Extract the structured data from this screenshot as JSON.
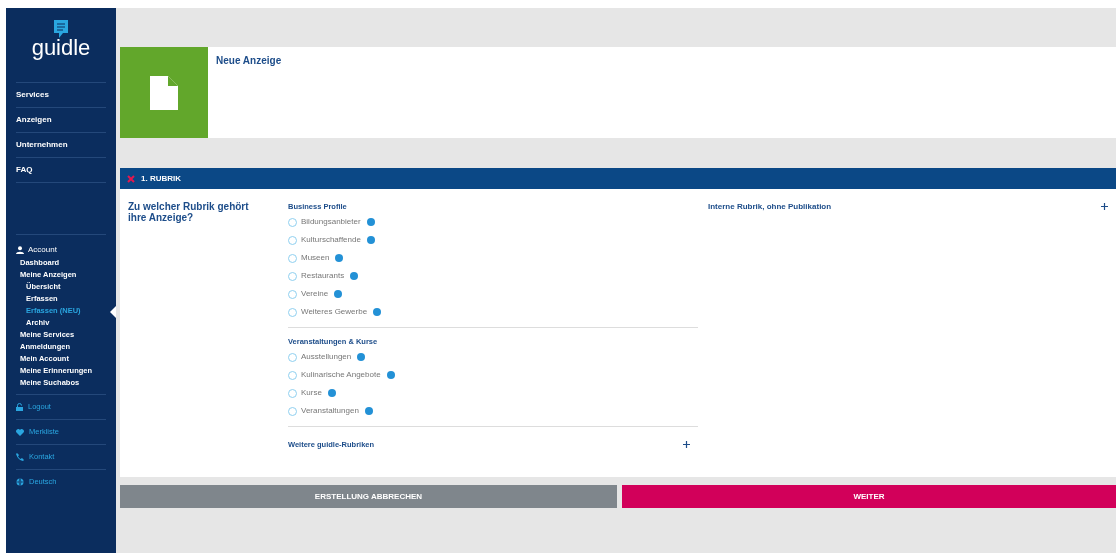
{
  "sidebar": {
    "logo": "guidle",
    "main_nav": [
      {
        "label": "Services"
      },
      {
        "label": "Anzeigen"
      },
      {
        "label": "Unternehmen"
      },
      {
        "label": "FAQ"
      }
    ],
    "account": {
      "label": "Account",
      "items": [
        {
          "label": "Dashboard",
          "selected": false
        },
        {
          "label": "Meine Anzeigen",
          "selected": false,
          "children": [
            {
              "label": "Übersicht",
              "selected": false
            },
            {
              "label": "Erfassen",
              "selected": false
            },
            {
              "label": "Erfassen (NEU)",
              "selected": true
            },
            {
              "label": "Archiv",
              "selected": false
            }
          ]
        },
        {
          "label": "Meine Services",
          "selected": false
        },
        {
          "label": "Anmeldungen",
          "selected": false
        },
        {
          "label": "Mein Account",
          "selected": false
        },
        {
          "label": "Meine Erinnerungen",
          "selected": false
        },
        {
          "label": "Meine Suchabos",
          "selected": false
        }
      ]
    },
    "footer_links": [
      {
        "kind": "lock",
        "label": "Logout"
      },
      {
        "kind": "heart",
        "label": "Merkliste"
      },
      {
        "kind": "phone",
        "label": "Kontakt"
      },
      {
        "kind": "globe",
        "label": "Deutsch"
      }
    ]
  },
  "header": {
    "title": "Neue Anzeige"
  },
  "section": {
    "title": "1. RUBRIK",
    "question": "Zu welcher Rubrik gehört ihre Anzeige?",
    "groups": [
      {
        "title": "Business Profile",
        "options": [
          {
            "label": "Bildungsanbieter",
            "selected": false
          },
          {
            "label": "Kulturschaffende",
            "selected": false
          },
          {
            "label": "Museen",
            "selected": false
          },
          {
            "label": "Restaurants",
            "selected": false
          },
          {
            "label": "Vereine",
            "selected": false
          },
          {
            "label": "Weiteres Gewerbe",
            "selected": false
          }
        ]
      },
      {
        "title": "Veranstaltungen & Kurse",
        "options": [
          {
            "label": "Ausstellungen",
            "selected": false
          },
          {
            "label": "Kulinarische Angebote",
            "selected": false
          },
          {
            "label": "Kurse",
            "selected": false
          },
          {
            "label": "Veranstaltungen",
            "selected": false
          }
        ]
      }
    ],
    "collapsed_groups": [
      {
        "title": "Weitere guidle-Rubriken",
        "expanded": false
      }
    ],
    "side_group": {
      "title": "Interne Rubrik, ohne Publikation",
      "expanded": false
    }
  },
  "buttons": {
    "cancel": "ERSTELLUNG ABBRECHEN",
    "next": "WEITER"
  }
}
